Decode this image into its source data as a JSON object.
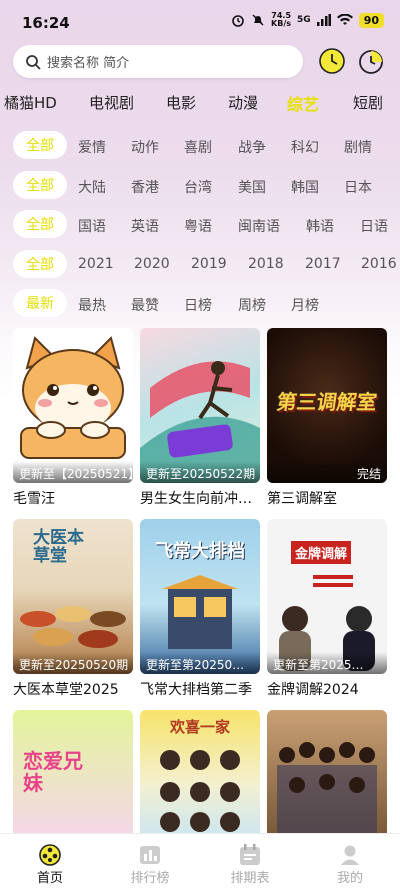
{
  "status": {
    "time": "16:24",
    "net_speed": "74.5",
    "net_unit": "KB/s",
    "signal": "5G",
    "battery": "90"
  },
  "search": {
    "placeholder": "搜索名称 简介"
  },
  "categories": [
    "橘猫HD",
    "电视剧",
    "电影",
    "动漫",
    "综艺",
    "短剧"
  ],
  "active_category": "综艺",
  "filters": [
    {
      "pill": "全部",
      "items": [
        "爱情",
        "动作",
        "喜剧",
        "战争",
        "科幻",
        "剧情"
      ]
    },
    {
      "pill": "全部",
      "items": [
        "大陆",
        "香港",
        "台湾",
        "美国",
        "韩国",
        "日本"
      ]
    },
    {
      "pill": "全部",
      "items": [
        "国语",
        "英语",
        "粤语",
        "闽南语",
        "韩语",
        "日语"
      ]
    },
    {
      "pill": "全部",
      "items": [
        "2021",
        "2020",
        "2019",
        "2018",
        "2017",
        "2016"
      ]
    },
    {
      "pill": "最新",
      "items": [
        "最热",
        "最赞",
        "日榜",
        "周榜",
        "月榜"
      ]
    }
  ],
  "cards": [
    {
      "title": "毛雪汪",
      "caption": "更新至【20250521】"
    },
    {
      "title": "男生女生向前冲…",
      "caption": "更新至20250522期"
    },
    {
      "title": "第三调解室",
      "caption": "完结",
      "poster_text": "第三调解室"
    },
    {
      "title": "大医本草堂2025",
      "caption": "更新至20250520期",
      "poster_text": "大医本草堂"
    },
    {
      "title": "飞常大排档第二季",
      "caption": "更新至第20250…",
      "poster_text": "飞常大排档"
    },
    {
      "title": "金牌调解2024",
      "caption": "更新至第2025…",
      "poster_text": "金牌调解"
    },
    {
      "title": "",
      "caption": "",
      "poster_text": "恋爱兄妹"
    },
    {
      "title": "",
      "caption": "",
      "poster_text": "欢喜一家"
    },
    {
      "title": "",
      "caption": ""
    }
  ],
  "tabs": [
    {
      "label": "首页",
      "active": true
    },
    {
      "label": "排行榜",
      "active": false
    },
    {
      "label": "排期表",
      "active": false
    },
    {
      "label": "我的",
      "active": false
    }
  ],
  "colors": {
    "accent": "#e8e000",
    "battery": "#f1de2a"
  }
}
